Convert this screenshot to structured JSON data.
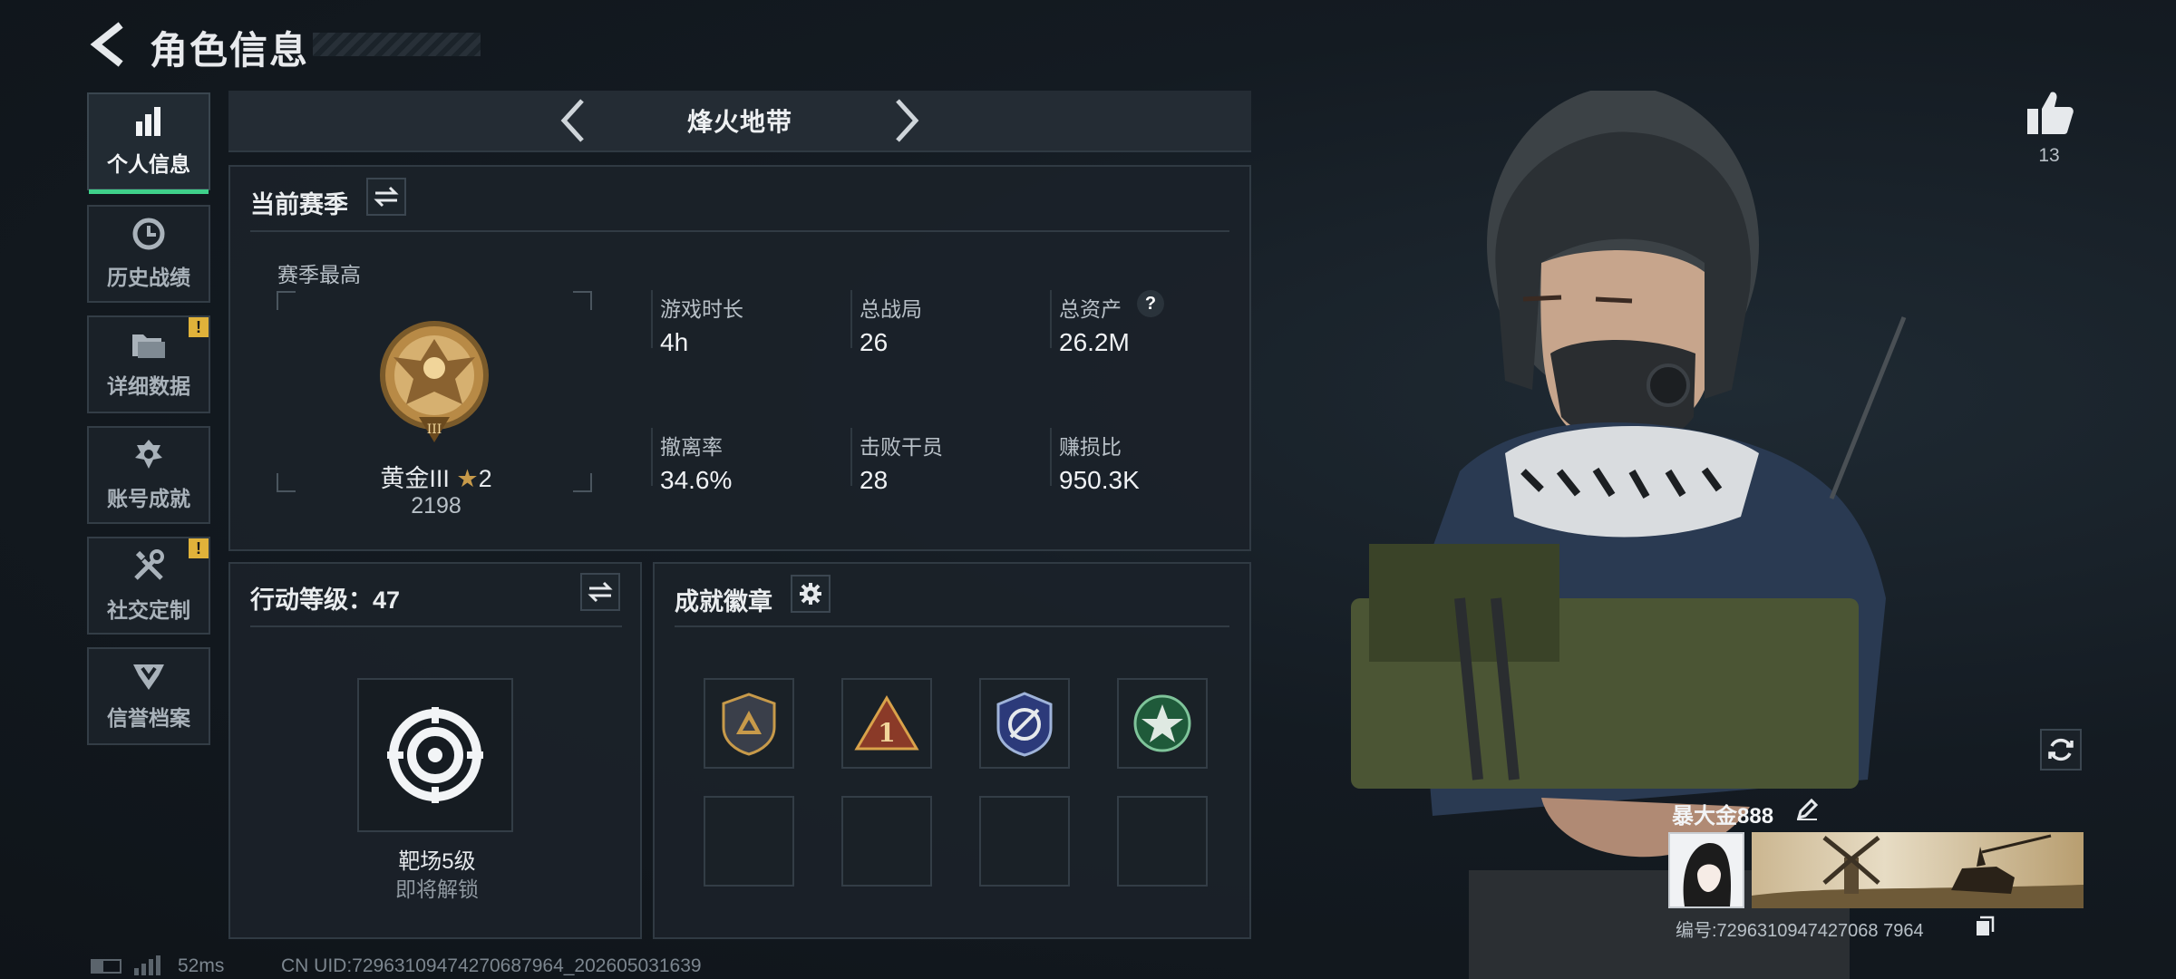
{
  "header": {
    "title": "角色信息"
  },
  "sidebar": {
    "items": [
      {
        "label": "个人信息",
        "icon": "bar-chart-icon",
        "active": true
      },
      {
        "label": "历史战绩",
        "icon": "clock-icon"
      },
      {
        "label": "详细数据",
        "icon": "folder-icon",
        "badge": "!"
      },
      {
        "label": "账号成就",
        "icon": "achievement-icon"
      },
      {
        "label": "社交定制",
        "icon": "tools-icon",
        "badge": "!"
      },
      {
        "label": "信誉档案",
        "icon": "credit-icon"
      }
    ]
  },
  "mode": {
    "name": "烽火地带"
  },
  "season": {
    "title": "当前赛季",
    "best_label": "赛季最高",
    "rank_name": "黄金III",
    "rank_stars": "2",
    "rank_points": "2198",
    "stats": [
      {
        "label": "游戏时长",
        "value": "4h"
      },
      {
        "label": "总战局",
        "value": "26"
      },
      {
        "label": "总资产",
        "value": "26.2M",
        "help": "?"
      },
      {
        "label": "撤离率",
        "value": "34.6%"
      },
      {
        "label": "击败干员",
        "value": "28"
      },
      {
        "label": "赚损比",
        "value": "950.3K"
      }
    ]
  },
  "action_level": {
    "title": "行动等级：47",
    "item_name": "靶场5级",
    "item_status": "即将解锁"
  },
  "achievements": {
    "title": "成就徽章"
  },
  "profile": {
    "likes": "13",
    "player_name": "暴大金888",
    "player_id": "编号:7296310947427068 7964"
  },
  "footer": {
    "ping": "52ms",
    "uid": "CN UID:72963109474270687964_202605031639"
  },
  "colors": {
    "accent": "#3fd08a",
    "warn": "#e0b23a",
    "gold": "#c79a4a"
  }
}
